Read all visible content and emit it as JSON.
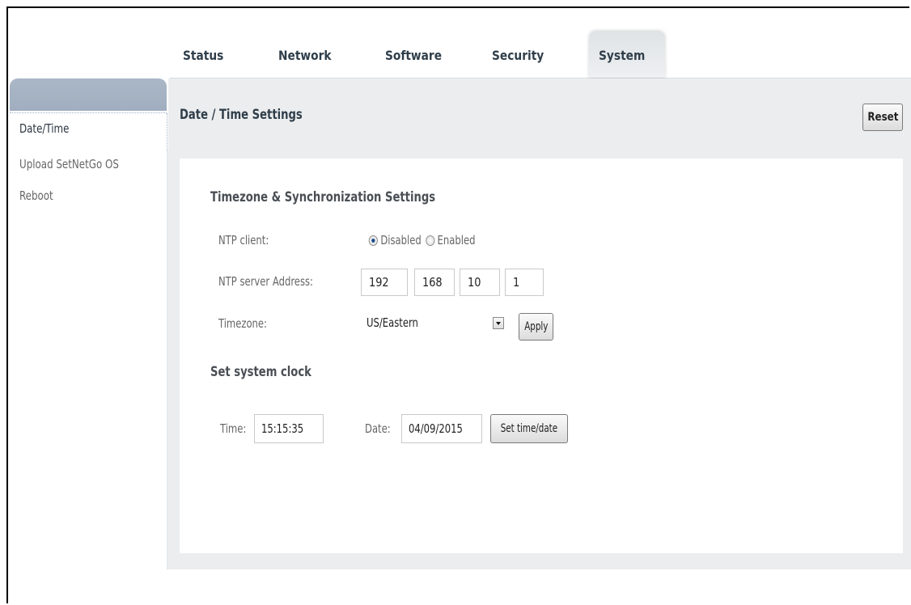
{
  "tabs": [
    {
      "label": "Status"
    },
    {
      "label": "Network"
    },
    {
      "label": "Software"
    },
    {
      "label": "Security"
    },
    {
      "label": "System",
      "active": true
    }
  ],
  "sidebar": {
    "items": [
      {
        "label": "Date/Time",
        "active": true
      },
      {
        "label": "Upload SetNetGo OS"
      },
      {
        "label": "Reboot"
      }
    ]
  },
  "page": {
    "title": "Date / Time Settings",
    "reset_label": "Reset"
  },
  "timezone_section": {
    "title": "Timezone & Synchronization Settings",
    "ntp_client_label": "NTP client:",
    "ntp_options": [
      "Disabled",
      "Enabled"
    ],
    "ntp_selected": "Disabled",
    "ntp_server_label": "NTP server Address:",
    "ntp_server_octets": [
      "192",
      "168",
      "10",
      "1"
    ],
    "timezone_label": "Timezone:",
    "timezone_value": "US/Eastern",
    "apply_label": "Apply"
  },
  "clock_section": {
    "title": "Set system clock",
    "time_label": "Time:",
    "time_value": "15:15:35",
    "date_label": "Date:",
    "date_value": "04/09/2015",
    "set_label": "Set time/date"
  },
  "colors": {
    "tab_text": "#2f3e4a",
    "sidebar_header": "#a5b3c4",
    "content_bg": "#ecedee"
  }
}
